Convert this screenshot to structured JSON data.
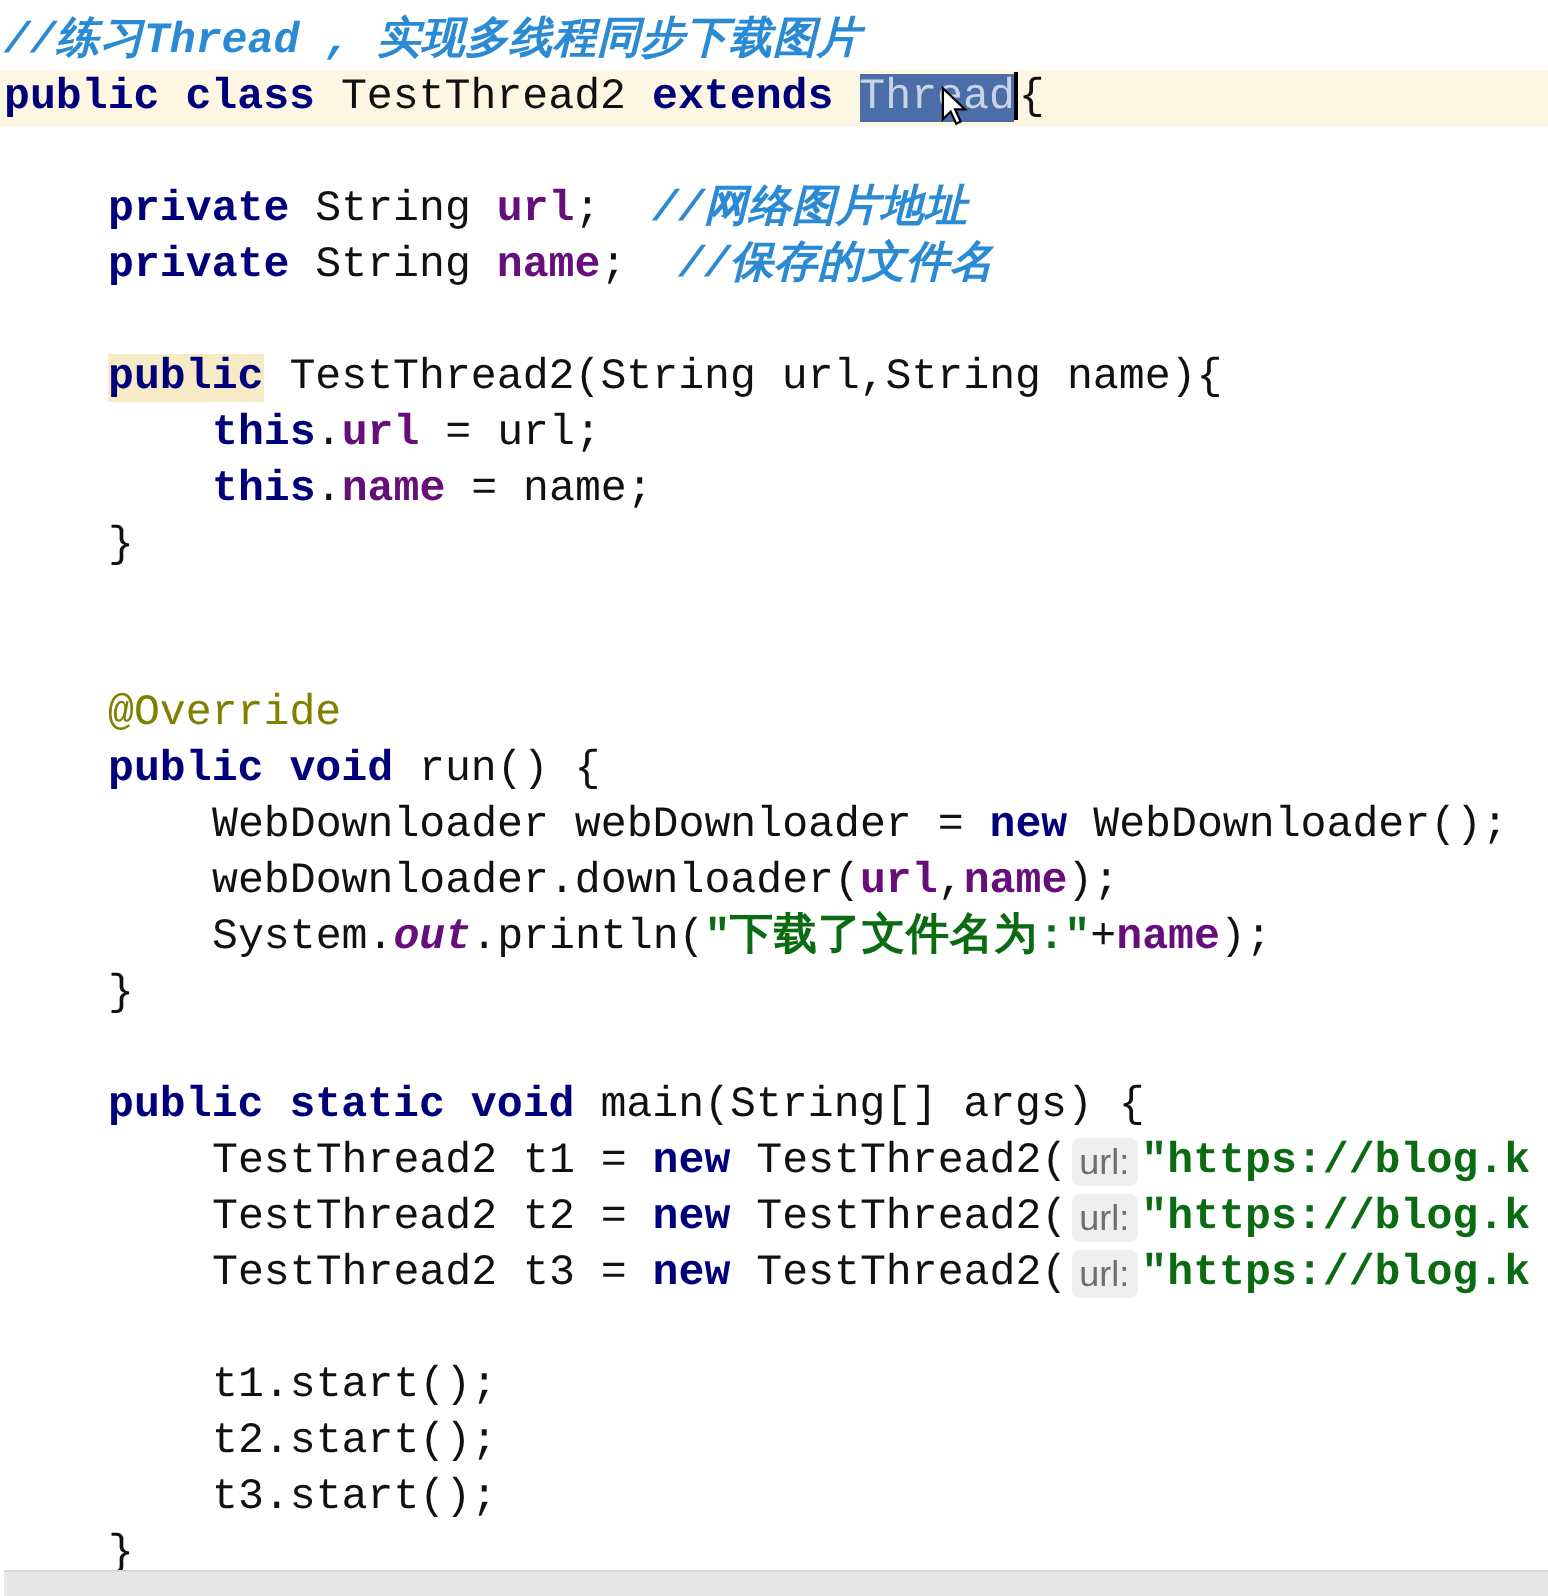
{
  "editor": {
    "lines": [
      {
        "current": false,
        "tokens": [
          {
            "text": "//练习Thread , 实现多线程同步下载图片",
            "kind": "doc_comment"
          }
        ]
      },
      {
        "current": true,
        "tokens": [
          {
            "text": "public class ",
            "kind": "keyword"
          },
          {
            "text": "TestThread2 ",
            "kind": "plain"
          },
          {
            "text": "extends ",
            "kind": "keyword"
          },
          {
            "text": "Thread",
            "kind": "selection"
          },
          {
            "text": "{",
            "kind": "plain"
          }
        ],
        "children": [
          {
            "current": false
          },
          {
            "current": false,
            "tokens": [
              {
                "text": "private ",
                "kind": "keyword"
              },
              {
                "text": "String ",
                "kind": "plain"
              },
              {
                "text": "url",
                "kind": "field"
              },
              {
                "text": ";  ",
                "kind": "plain"
              },
              {
                "text": "//网络图片地址",
                "kind": "comment"
              }
            ]
          },
          {
            "current": false,
            "tokens": [
              {
                "text": "private ",
                "kind": "keyword"
              },
              {
                "text": "String ",
                "kind": "plain"
              },
              {
                "text": "name",
                "kind": "field"
              },
              {
                "text": ";  ",
                "kind": "plain"
              },
              {
                "text": "//保存的文件名",
                "kind": "comment"
              }
            ]
          },
          {
            "current": false
          },
          {
            "current": false,
            "tokens": [
              {
                "text": "public",
                "kind": "usage_keyword"
              },
              {
                "text": " TestThread2(String url,String name){",
                "kind": "plain"
              }
            ],
            "children": [
              {
                "current": false,
                "tokens": [
                  {
                    "text": "this",
                    "kind": "keyword"
                  },
                  {
                    "text": ".",
                    "kind": "plain"
                  },
                  {
                    "text": "url",
                    "kind": "field"
                  },
                  {
                    "text": " = url;",
                    "kind": "plain"
                  }
                ]
              },
              {
                "current": false,
                "tokens": [
                  {
                    "text": "this",
                    "kind": "keyword"
                  },
                  {
                    "text": ".",
                    "kind": "plain"
                  },
                  {
                    "text": "name",
                    "kind": "field"
                  },
                  {
                    "text": " = name;",
                    "kind": "plain"
                  }
                ]
              }
            ]
          },
          {
            "current": false,
            "tokens": [
              {
                "text": "}",
                "kind": "plain"
              }
            ]
          },
          {
            "current": false
          },
          {
            "current": false
          },
          {
            "current": false,
            "tokens": [
              {
                "text": "@Override",
                "kind": "annotation"
              }
            ]
          },
          {
            "current": false,
            "tokens": [
              {
                "text": "public void ",
                "kind": "keyword"
              },
              {
                "text": "run() {",
                "kind": "plain"
              }
            ],
            "children": [
              {
                "current": false,
                "tokens": [
                  {
                    "text": "WebDownloader webDownloader = ",
                    "kind": "plain"
                  },
                  {
                    "text": "new ",
                    "kind": "keyword"
                  },
                  {
                    "text": "WebDownloader();",
                    "kind": "plain"
                  }
                ]
              },
              {
                "current": false,
                "tokens": [
                  {
                    "text": "webDownloader.downloader(",
                    "kind": "plain"
                  },
                  {
                    "text": "url",
                    "kind": "field"
                  },
                  {
                    "text": ",",
                    "kind": "plain"
                  },
                  {
                    "text": "name",
                    "kind": "field"
                  },
                  {
                    "text": ");",
                    "kind": "plain"
                  }
                ]
              },
              {
                "current": false,
                "tokens": [
                  {
                    "text": "System.",
                    "kind": "plain"
                  },
                  {
                    "text": "out",
                    "kind": "static_field"
                  },
                  {
                    "text": ".println(",
                    "kind": "plain"
                  },
                  {
                    "text": "\"下载了文件名为:\"",
                    "kind": "string"
                  },
                  {
                    "text": "+",
                    "kind": "plain"
                  },
                  {
                    "text": "name",
                    "kind": "field"
                  },
                  {
                    "text": ");",
                    "kind": "plain"
                  }
                ]
              }
            ]
          },
          {
            "current": false,
            "tokens": [
              {
                "text": "}",
                "kind": "plain"
              }
            ]
          },
          {
            "current": false
          },
          {
            "current": false,
            "tokens": [
              {
                "text": "public static void ",
                "kind": "keyword"
              },
              {
                "text": "main(String[] args) {",
                "kind": "plain"
              }
            ],
            "children": [
              {
                "current": false,
                "tokens": [
                  {
                    "text": "TestThread2 t1 = ",
                    "kind": "plain"
                  },
                  {
                    "text": "new ",
                    "kind": "keyword"
                  },
                  {
                    "text": "TestThread2(",
                    "kind": "plain"
                  },
                  {
                    "text": "url:",
                    "kind": "hint"
                  },
                  {
                    "text": "\"https://blog.k",
                    "kind": "string"
                  }
                ]
              },
              {
                "current": false,
                "tokens": [
                  {
                    "text": "TestThread2 t2 = ",
                    "kind": "plain"
                  },
                  {
                    "text": "new ",
                    "kind": "keyword"
                  },
                  {
                    "text": "TestThread2(",
                    "kind": "plain"
                  },
                  {
                    "text": "url:",
                    "kind": "hint"
                  },
                  {
                    "text": "\"https://blog.k",
                    "kind": "string"
                  }
                ]
              },
              {
                "current": false,
                "tokens": [
                  {
                    "text": "TestThread2 t3 = ",
                    "kind": "plain"
                  },
                  {
                    "text": "new ",
                    "kind": "keyword"
                  },
                  {
                    "text": "TestThread2(",
                    "kind": "plain"
                  },
                  {
                    "text": "url:",
                    "kind": "hint"
                  },
                  {
                    "text": "\"https://blog.k",
                    "kind": "string"
                  }
                ]
              },
              {
                "current": false
              },
              {
                "current": false,
                "tokens": [
                  {
                    "text": "t1.start();",
                    "kind": "plain"
                  }
                ]
              },
              {
                "current": false,
                "tokens": [
                  {
                    "text": "t2.start();",
                    "kind": "plain"
                  }
                ]
              },
              {
                "current": false,
                "tokens": [
                  {
                    "text": "t3.start();",
                    "kind": "plain"
                  }
                ]
              }
            ]
          },
          {
            "current": false,
            "tokens": [
              {
                "text": "}",
                "kind": "plain"
              }
            ]
          }
        ]
      }
    ]
  }
}
